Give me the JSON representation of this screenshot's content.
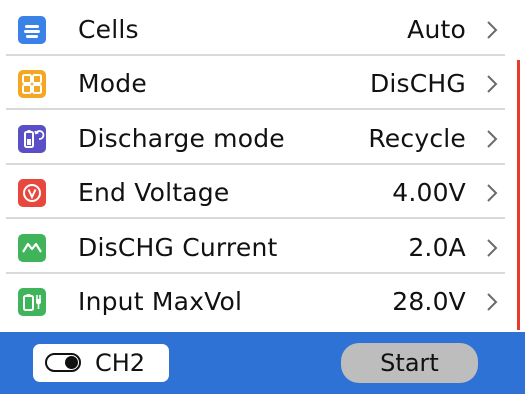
{
  "settings": {
    "rows": [
      {
        "label": "Cells",
        "value": "Auto",
        "icon": "cells-icon",
        "icon_color": "#3b82e8"
      },
      {
        "label": "Mode",
        "value": "DisCHG",
        "icon": "mode-grid-icon",
        "icon_color": "#f5a623"
      },
      {
        "label": "Discharge mode",
        "value": "Recycle",
        "icon": "battery-cycle-icon",
        "icon_color": "#5b4fc7"
      },
      {
        "label": "End Voltage",
        "value": "4.00V",
        "icon": "voltage-icon",
        "icon_color": "#e8473e"
      },
      {
        "label": "DisCHG Current",
        "value": "2.0A",
        "icon": "current-wave-icon",
        "icon_color": "#3fb45a"
      },
      {
        "label": "Input MaxVol",
        "value": "28.0V",
        "icon": "battery-power-icon",
        "icon_color": "#3fb45a"
      }
    ]
  },
  "bottom_bar": {
    "channel_label": "CH2",
    "start_label": "Start",
    "bar_color": "#2f72d6"
  },
  "scrollbar": {
    "thumb_color": "#e83a2f"
  }
}
